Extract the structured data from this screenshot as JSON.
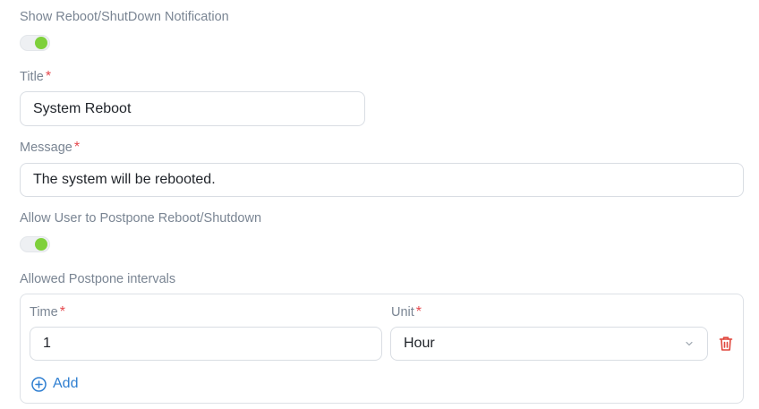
{
  "show_notification": {
    "label": "Show Reboot/ShutDown Notification",
    "enabled": true
  },
  "title_field": {
    "label": "Title",
    "required_mark": "*",
    "value": "System Reboot"
  },
  "message_field": {
    "label": "Message",
    "required_mark": "*",
    "value": "The system will be rebooted."
  },
  "allow_postpone": {
    "label": "Allow User to Postpone Reboot/Shutdown",
    "enabled": true
  },
  "postpone_intervals": {
    "label": "Allowed Postpone intervals",
    "time_label": "Time",
    "unit_label": "Unit",
    "required_mark": "*",
    "rows": [
      {
        "time": "1",
        "unit": "Hour"
      }
    ],
    "add_label": "Add"
  },
  "colors": {
    "accent_blue": "#2f7fd1",
    "toggle_on": "#7ed03b",
    "required_red": "#e5484d",
    "delete_red": "#e0463c"
  },
  "icons": {
    "delete": "trash-icon",
    "add": "plus-circle-icon",
    "dropdown": "chevron-down-icon"
  }
}
